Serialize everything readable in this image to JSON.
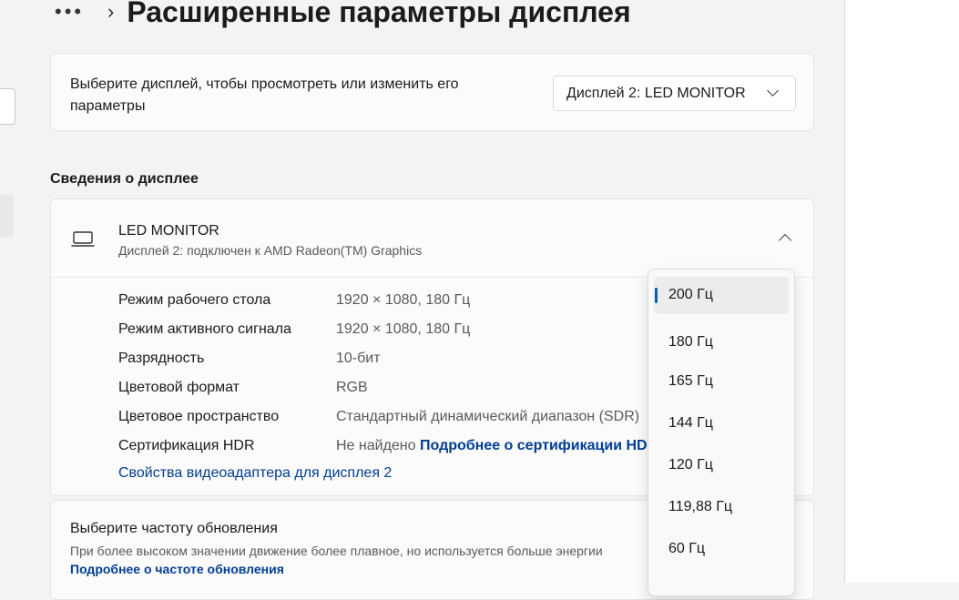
{
  "header": {
    "dots": "•••",
    "chevron": "›",
    "title": "Расширенные параметры дисплея"
  },
  "display_select": {
    "label": "Выберите дисплей, чтобы просмотреть или изменить его параметры",
    "value": "Дисплей 2: LED MONITOR"
  },
  "section": {
    "heading": "Сведения о дисплее"
  },
  "monitor": {
    "name": "LED MONITOR",
    "subtitle": "Дисплей 2: подключен к AMD Radeon(TM) Graphics",
    "rows": [
      {
        "key": "Режим рабочего стола",
        "value": "1920 × 1080, 180 Гц"
      },
      {
        "key": "Режим активного сигнала",
        "value": "1920 × 1080, 180 Гц"
      },
      {
        "key": "Разрядность",
        "value": "10-бит"
      },
      {
        "key": "Цветовой формат",
        "value": "RGB"
      },
      {
        "key": "Цветовое пространство",
        "value": "Стандартный динамический диапазон (SDR)"
      },
      {
        "key": "Сертификация HDR",
        "value": "Не найдено",
        "link": "Подробнее о сертификации HDR"
      }
    ],
    "adapter_link": "Свойства видеоадаптера для дисплея 2"
  },
  "refresh": {
    "title": "Выберите частоту обновления",
    "description": "При более высоком значении движение более плавное, но используется больше энергии",
    "link": "Подробнее о частоте обновления"
  },
  "refresh_options": [
    "200 Гц",
    "180 Гц",
    "165 Гц",
    "144 Гц",
    "120 Гц",
    "119,88 Гц",
    "60 Гц"
  ],
  "selected_option": "200 Гц",
  "colors": {
    "accent": "#005fb8",
    "link": "#003e92"
  }
}
